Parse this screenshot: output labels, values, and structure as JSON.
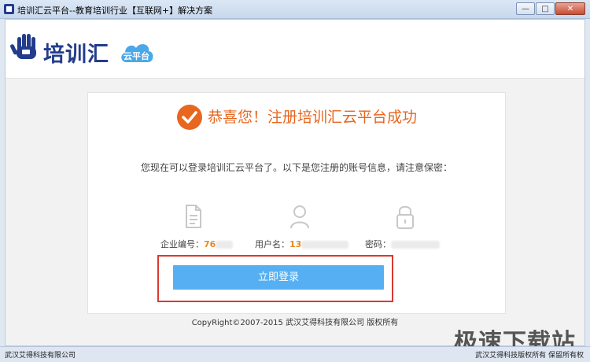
{
  "window": {
    "title": "培训汇云平台--教育培训行业【互联网+】解决方案",
    "minimize": "—",
    "maximize": "□",
    "close": "✕"
  },
  "header": {
    "logo_text": "培训汇",
    "logo_badge": "云平台"
  },
  "card": {
    "title": "恭喜您！注册培训汇云平台成功",
    "info": "您现在可以登录培训汇云平台了。以下是您注册的账号信息，请注意保密：",
    "fields": [
      {
        "label": "企业编号：",
        "value": "76",
        "icon": "document-icon"
      },
      {
        "label": "用户名：",
        "value": "13",
        "icon": "user-icon"
      },
      {
        "label": "密码：",
        "value": "",
        "icon": "lock-icon"
      }
    ],
    "login_button": "立即登录"
  },
  "footer": {
    "copyright": "CopyRight©2007-2015 武汉艾得科技有限公司 版权所有"
  },
  "statusbar": {
    "left": "武汉艾得科技有限公司",
    "right": "武汉艾得科技版权所有 保留所有权"
  },
  "watermark": "极速下载站",
  "colors": {
    "accent_orange": "#e8661e",
    "button_blue": "#56aff2",
    "highlight_red": "#d93a2f",
    "logo_navy": "#233c8c"
  }
}
